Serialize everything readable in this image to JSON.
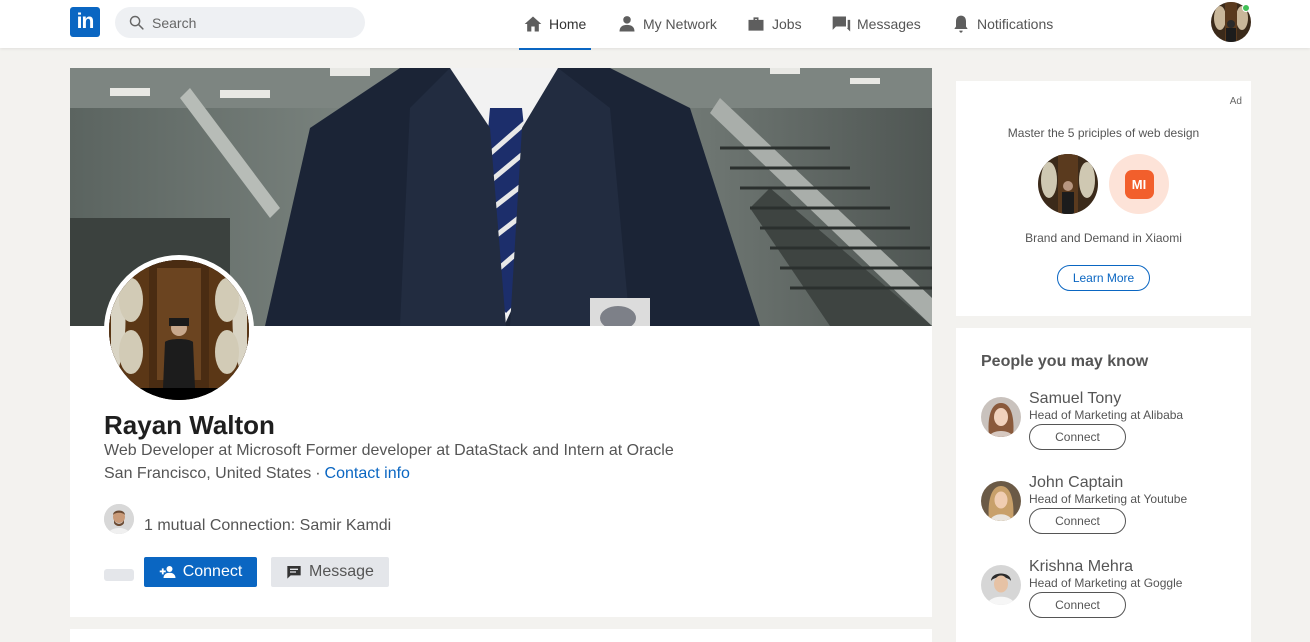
{
  "nav": {
    "logo": "in",
    "search_placeholder": "Search",
    "items": [
      {
        "label": "Home",
        "icon": "home-icon",
        "active": true
      },
      {
        "label": "My Network",
        "icon": "people-icon"
      },
      {
        "label": "Jobs",
        "icon": "briefcase-icon"
      },
      {
        "label": "Messages",
        "icon": "chat-icon"
      },
      {
        "label": "Notifications",
        "icon": "bell-icon"
      }
    ],
    "accent": "#0a66c2",
    "online_color": "#40c057"
  },
  "profile": {
    "name": "Rayan Walton",
    "headline": "Web Developer at Microsoft Former developer at DataStack and Intern at Oracle",
    "location": "San Francisco, United States",
    "separator": "·",
    "contact_label": "Contact info",
    "mutual": "1 mutual Connection: Samir Kamdi",
    "connect_label": "Connect",
    "message_label": "Message"
  },
  "ad": {
    "label": "Ad",
    "title": "Master the 5 priciples of web design",
    "brand_logo_text": "MI",
    "subtitle": "Brand and Demand in Xiaomi",
    "button": "Learn More"
  },
  "pymk": {
    "title": "People you may know",
    "people": [
      {
        "name": "Samuel Tony",
        "title": "Head of Marketing at Alibaba",
        "button": "Connect"
      },
      {
        "name": "John Captain",
        "title": "Head of Marketing at Youtube",
        "button": "Connect"
      },
      {
        "name": "Krishna Mehra",
        "title": "Head of Marketing at Goggle",
        "button": "Connect"
      }
    ]
  }
}
